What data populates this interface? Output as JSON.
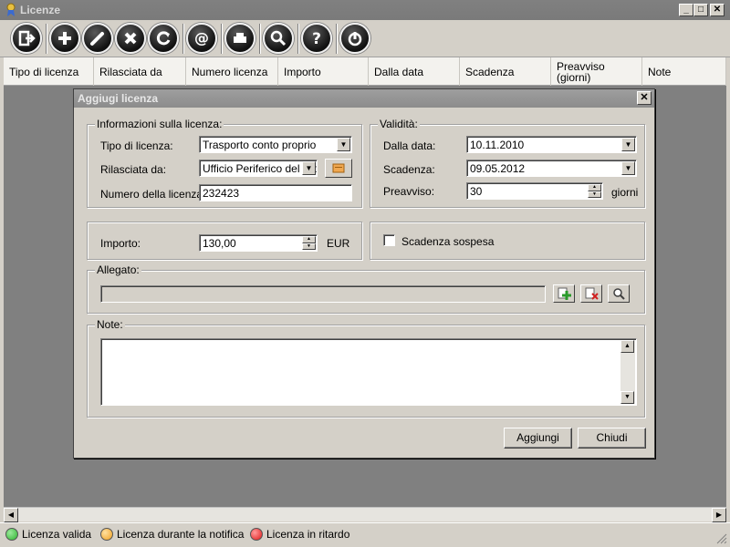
{
  "window": {
    "title": "Licenze"
  },
  "columns": [
    "Tipo di licenza",
    "Rilasciata da",
    "Numero licenza",
    "Importo",
    "Dalla data",
    "Scadenza",
    "Preavviso (giorni)",
    "Note"
  ],
  "dialog": {
    "title": "Aggiugi licenza",
    "info_group": "Informazioni sulla licenza:",
    "validity_group": "Validità:",
    "tipo_label": "Tipo di licenza:",
    "tipo_value": "Trasporto conto proprio",
    "rilasciata_label": "Rilasciata da:",
    "rilasciata_value": "Ufficio Periferico del Dip",
    "numero_label": "Numero della licenza:",
    "numero_value": "232423",
    "dalla_label": "Dalla data:",
    "dalla_value": "10.11.2010",
    "scadenza_label": "Scadenza:",
    "scadenza_value": "09.05.2012",
    "preavviso_label": "Preavviso:",
    "preavviso_value": "30",
    "preavviso_unit": "giorni",
    "importo_label": "Importo:",
    "importo_value": "130,00",
    "importo_unit": "EUR",
    "scadenza_sospesa": "Scadenza sospesa",
    "allegato_group": "Allegato:",
    "allegato_value": "",
    "note_group": "Note:",
    "note_value": "",
    "add_button": "Aggiungi",
    "close_button": "Chiudi"
  },
  "status": {
    "valid": "Licenza valida",
    "notice": "Licenza durante la notifica",
    "late": "Licenza in ritardo",
    "colors": {
      "valid": "#2fb52f",
      "notice": "#f0a020",
      "late": "#e01818"
    }
  }
}
